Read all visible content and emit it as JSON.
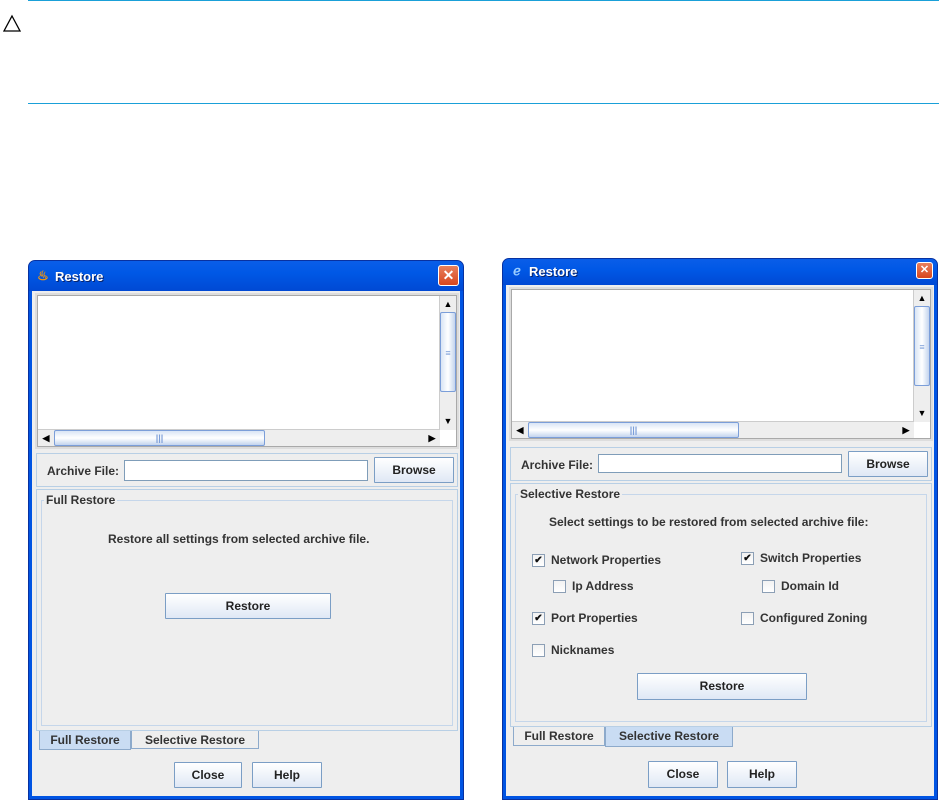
{
  "caution_icon": "warning-triangle-icon",
  "dialogs": [
    {
      "title": "Restore",
      "icon": "java-cup-icon",
      "archive_label": "Archive File:",
      "archive_value": "",
      "browse_label": "Browse",
      "group_title": "Full Restore",
      "message": "Restore all settings from selected archive file.",
      "restore_label": "Restore",
      "tabs": [
        "Full Restore",
        "Selective Restore"
      ],
      "active_tab": "Full Restore",
      "close_label": "Close",
      "help_label": "Help"
    },
    {
      "title": "Restore",
      "icon": "ie-icon",
      "archive_label": "Archive File:",
      "archive_value": "",
      "browse_label": "Browse",
      "group_title": "Selective Restore",
      "message": "Select settings to be restored from selected archive file:",
      "options": [
        {
          "label": "Network Properties",
          "checked": true
        },
        {
          "label": "Ip Address",
          "checked": false
        },
        {
          "label": "Port Properties",
          "checked": true
        },
        {
          "label": "Nicknames",
          "checked": false
        },
        {
          "label": "Switch Properties",
          "checked": true
        },
        {
          "label": "Domain Id",
          "checked": false
        },
        {
          "label": "Configured Zoning",
          "checked": false
        }
      ],
      "restore_label": "Restore",
      "tabs": [
        "Full Restore",
        "Selective Restore"
      ],
      "active_tab": "Selective Restore",
      "close_label": "Close",
      "help_label": "Help"
    }
  ]
}
